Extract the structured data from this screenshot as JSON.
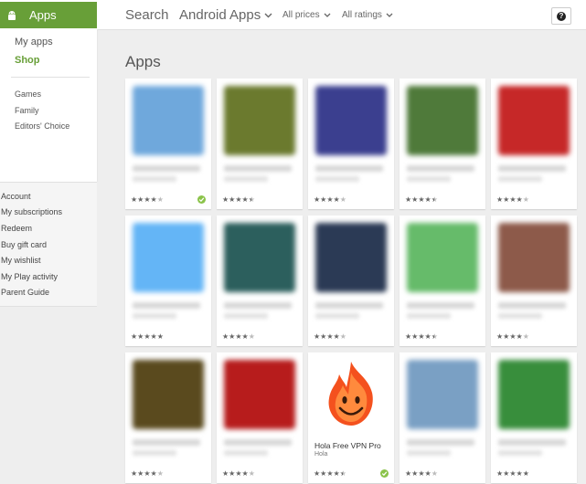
{
  "header": {
    "apps_tab_label": "Apps",
    "search_label": "Search",
    "category_select": "Android Apps",
    "price_filter": "All prices",
    "rating_filter": "All ratings",
    "help_label": "?"
  },
  "sidebar": {
    "my_apps": "My apps",
    "shop": "Shop",
    "categories": [
      "Games",
      "Family",
      "Editors' Choice"
    ],
    "account_links": [
      "Account",
      "My subscriptions",
      "Redeem",
      "Buy gift card",
      "My wishlist",
      "My Play activity",
      "Parent Guide"
    ]
  },
  "section_title": "Apps",
  "colors": {
    "accent": "#689f38",
    "check": "#8bc34a"
  },
  "cards": [
    {
      "thumb": "#6fa8dc",
      "stars": 4,
      "installed": true
    },
    {
      "thumb": "#6b7a2e",
      "stars": 4.5,
      "installed": false
    },
    {
      "thumb": "#3b3f8f",
      "stars": 4,
      "installed": false
    },
    {
      "thumb": "#4f7a3a",
      "stars": 4.5,
      "installed": false
    },
    {
      "thumb": "#c62828",
      "stars": 4,
      "installed": false
    },
    {
      "thumb": "#64b5f6",
      "stars": 5,
      "installed": false
    },
    {
      "thumb": "#2c5f5d",
      "stars": 4,
      "installed": false
    },
    {
      "thumb": "#2b3a55",
      "stars": 4,
      "installed": false
    },
    {
      "thumb": "#66bb6a",
      "stars": 4.5,
      "installed": false
    },
    {
      "thumb": "#8d5a4a",
      "stars": 4,
      "installed": false
    },
    {
      "thumb": "#5a4a1e",
      "stars": 4,
      "installed": false
    },
    {
      "thumb": "#b71c1c",
      "stars": 4,
      "installed": false
    },
    {
      "thumb": "#ffffff",
      "stars": 4.5,
      "installed": true,
      "title": "Hola Free VPN Pro",
      "subtitle": "Hola"
    },
    {
      "thumb": "#7aa0c4",
      "stars": 4,
      "installed": false
    },
    {
      "thumb": "#388e3c",
      "stars": 5,
      "installed": false
    }
  ]
}
